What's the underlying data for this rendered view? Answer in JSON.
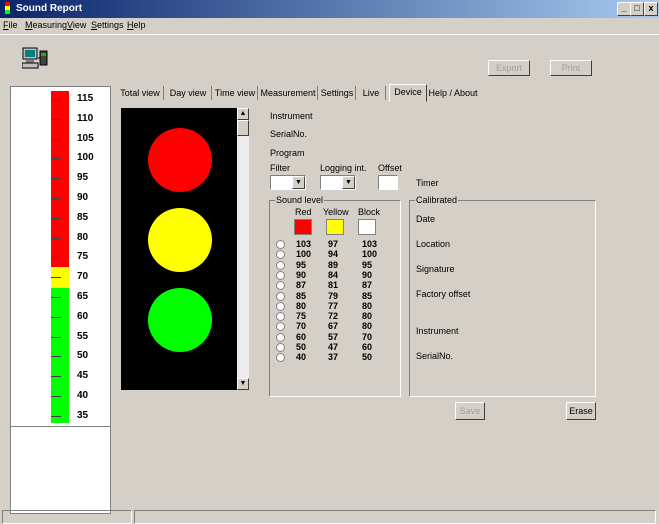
{
  "window": {
    "title": "Sound Report",
    "min": "_",
    "max": "□",
    "close": "x"
  },
  "menu": [
    "File",
    "Measuring",
    "View",
    "Settings",
    "Help"
  ],
  "toolbar": {
    "export_label": "Export",
    "print_label": "Print"
  },
  "scale": {
    "labels": [
      "115",
      "110",
      "105",
      "100",
      "95",
      "90",
      "85",
      "80",
      "75",
      "70",
      "65",
      "60",
      "55",
      "50",
      "45",
      "40",
      "35"
    ],
    "colors": {
      "red": "#ff0000",
      "yellow": "#ffff00",
      "green": "#00ff00"
    }
  },
  "tabs": [
    "Total view",
    "Day view",
    "Time view",
    "Measurement",
    "Settings",
    "Live",
    "Device",
    "Help / About"
  ],
  "active_tab": "Device",
  "lights": {
    "red": "#ff0000",
    "yellow": "#ffff00",
    "green": "#00ff00",
    "housing": "#000000"
  },
  "device": {
    "instrument_label": "Instrument",
    "serial_label": "SerialNo.",
    "program_label": "Program",
    "filter_label": "Filter",
    "logging_label": "Logging int.",
    "offset_label": "Offset",
    "timer_label": "Timer",
    "sound_level_title": "Sound level",
    "col_red": "Red",
    "col_yellow": "Yellow",
    "col_block": "Block",
    "levels": [
      [
        "103",
        "97",
        "103"
      ],
      [
        "100",
        "94",
        "100"
      ],
      [
        "95",
        "89",
        "95"
      ],
      [
        "90",
        "84",
        "90"
      ],
      [
        "87",
        "81",
        "87"
      ],
      [
        "85",
        "79",
        "85"
      ],
      [
        "80",
        "77",
        "80"
      ],
      [
        "75",
        "72",
        "80"
      ],
      [
        "70",
        "67",
        "80"
      ],
      [
        "60",
        "57",
        "70"
      ],
      [
        "50",
        "47",
        "60"
      ],
      [
        "40",
        "37",
        "50"
      ]
    ],
    "calibrated_title": "Calibrated",
    "date_label": "Date",
    "location_label": "Location",
    "signature_label": "Signature",
    "factory_offset_label": "Factory offset",
    "cal_instrument_label": "Instrument",
    "cal_serial_label": "SerialNo.",
    "save_label": "Save",
    "erase_label": "Erase"
  }
}
